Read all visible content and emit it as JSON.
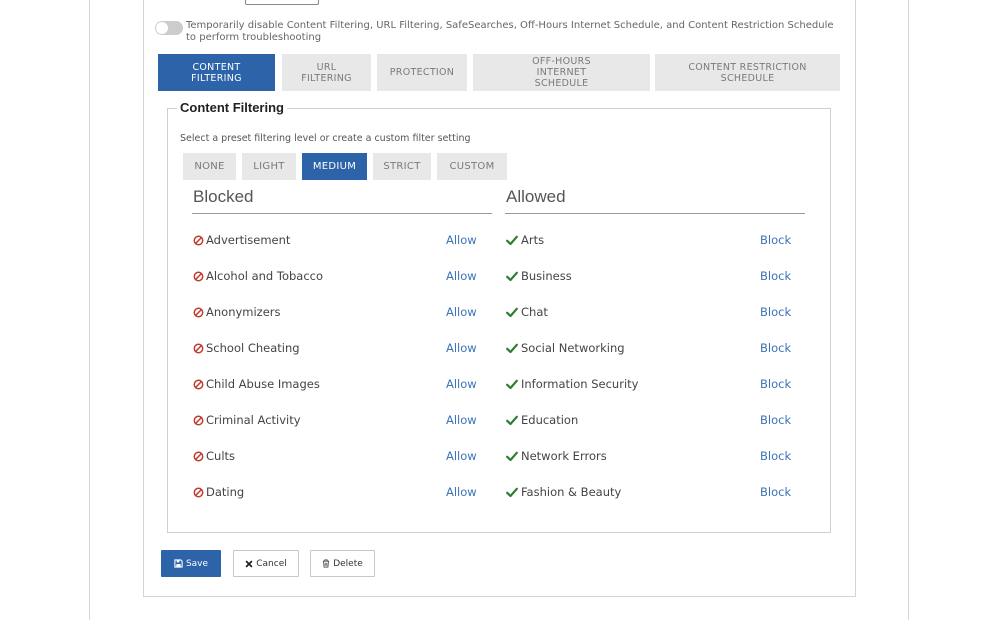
{
  "troubleshoot": {
    "text": "Temporarily disable Content Filtering, URL Filtering, SafeSearches, Off-Hours Internet Schedule, and Content Restriction Schedule to perform troubleshooting",
    "enabled": false
  },
  "tabs": [
    {
      "label": "CONTENT FILTERING",
      "active": true
    },
    {
      "label": "URL FILTERING",
      "active": false
    },
    {
      "label": "PROTECTION",
      "active": false
    },
    {
      "label": "OFF-HOURS INTERNET SCHEDULE",
      "active": false
    },
    {
      "label": "CONTENT RESTRICTION SCHEDULE",
      "active": false
    }
  ],
  "section": {
    "title": "Content Filtering",
    "instruction": "Select a preset filtering level or create a custom filter setting"
  },
  "presets": [
    {
      "label": "NONE",
      "active": false
    },
    {
      "label": "LIGHT",
      "active": false
    },
    {
      "label": "MEDIUM",
      "active": true
    },
    {
      "label": "STRICT",
      "active": false
    },
    {
      "label": "CUSTOM",
      "active": false
    }
  ],
  "blocked": {
    "heading": "Blocked",
    "action_label": "Allow",
    "items": [
      "Advertisement",
      "Alcohol and Tobacco",
      "Anonymizers",
      "School Cheating",
      "Child Abuse Images",
      "Criminal Activity",
      "Cults",
      "Dating"
    ]
  },
  "allowed": {
    "heading": "Allowed",
    "action_label": "Block",
    "items": [
      "Arts",
      "Business",
      "Chat",
      "Social Networking",
      "Information Security",
      "Education",
      "Network Errors",
      "Fashion & Beauty"
    ]
  },
  "buttons": {
    "save": "Save",
    "cancel": "Cancel",
    "delete": "Delete"
  },
  "colors": {
    "accent": "#2c63a9",
    "blocked_icon": "#c0392b",
    "allowed_icon": "#2e7d32",
    "link": "#3a73b8"
  },
  "icons": {
    "blocked": "no-entry-icon",
    "allowed": "checkmark-icon",
    "save": "floppy-disk-icon",
    "cancel": "x-icon",
    "delete": "trash-icon"
  }
}
